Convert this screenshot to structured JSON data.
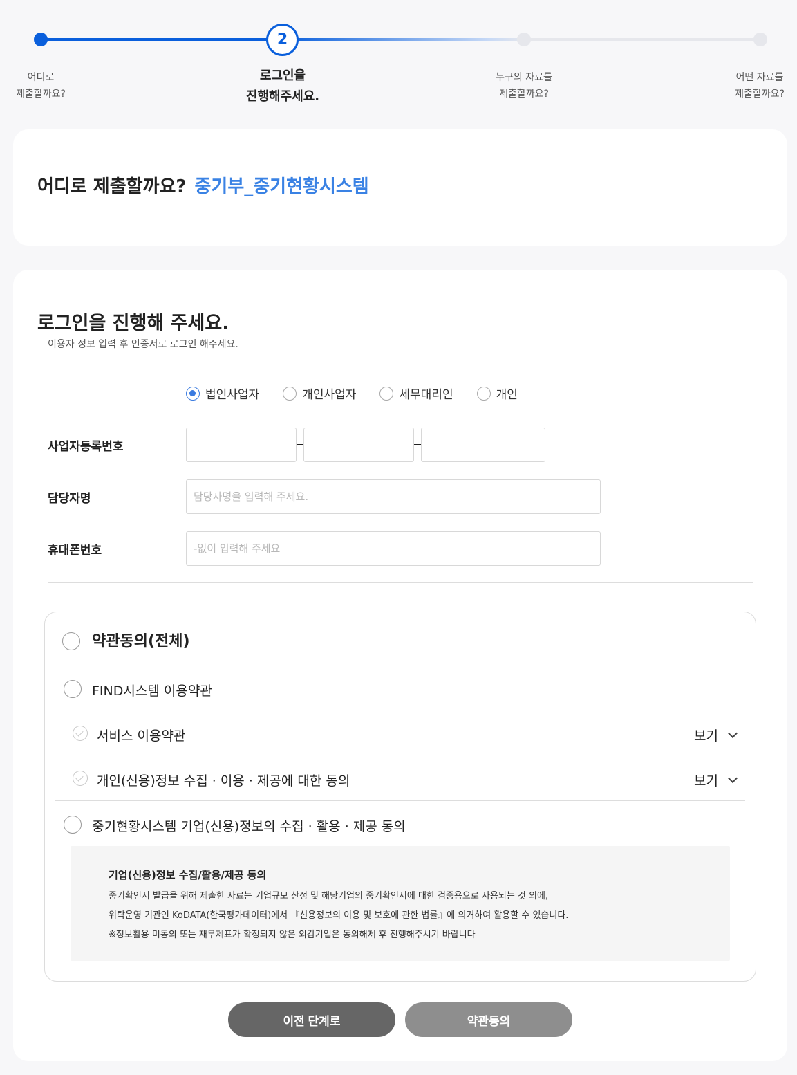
{
  "stepper": {
    "current_number": "2",
    "steps": [
      {
        "line1": "어디로",
        "line2": "제출할까요?"
      },
      {
        "line1": "로그인을",
        "line2": "진행해주세요."
      },
      {
        "line1": "누구의 자료를",
        "line2": "제출할까요?"
      },
      {
        "line1": "어떤 자료를",
        "line2": "제출할까요?"
      }
    ]
  },
  "destination": {
    "label": "어디로 제출할까요?",
    "value": "중기부_중기현황시스템"
  },
  "login": {
    "title": "로그인을 진행해 주세요.",
    "subtitle": "이용자 정보 입력 후 인증서로 로그인 해주세요.",
    "types": [
      {
        "label": "법인사업자",
        "selected": true
      },
      {
        "label": "개인사업자",
        "selected": false
      },
      {
        "label": "세무대리인",
        "selected": false
      },
      {
        "label": "개인",
        "selected": false
      }
    ],
    "fields": {
      "biz_number_label": "사업자등록번호",
      "biz_number_parts": [
        "",
        "",
        ""
      ],
      "manager_label": "담당자명",
      "manager_placeholder": "담당자명을 입력해 주세요.",
      "manager_value": "",
      "phone_label": "휴대폰번호",
      "phone_placeholder": "-없이 입력해 주세요",
      "phone_value": ""
    }
  },
  "terms": {
    "all_label": "약관동의(전체)",
    "find_label": "FIND시스템 이용약관",
    "service_label": "서비스 이용약관",
    "privacy_label": "개인(신용)정보 수집 · 이용 · 제공에 대한 동의",
    "view_label": "보기",
    "system_label": "중기현황시스템 기업(신용)정보의 수집 · 활용 · 제공 동의",
    "notice": {
      "title": "기업(신용)정보 수집/활용/제공 동의",
      "line1": "중기확인서 발급을 위해 제출한 자료는 기업규모 산정 및 해당기업의 중기확인서에 대한 검증용으로 사용되는 것 외에,",
      "line2": "위탁운영 기관인 KoDATA(한국평가데이터)에서 『신용정보의 이용 및 보호에 관한 법률』에 의거하여 활용할 수 있습니다.",
      "line3": "※정보활용 미동의 또는 재무제표가 확정되지 않은 외감기업은 동의해제 후 진행해주시기 바랍니다"
    }
  },
  "buttons": {
    "prev": "이전 단계로",
    "agree": "약관동의"
  },
  "colors": {
    "accent": "#0a5fdc",
    "destination_value": "#3a82e4",
    "btn_prev": "#666666",
    "btn_agree": "#8e8e8e"
  }
}
